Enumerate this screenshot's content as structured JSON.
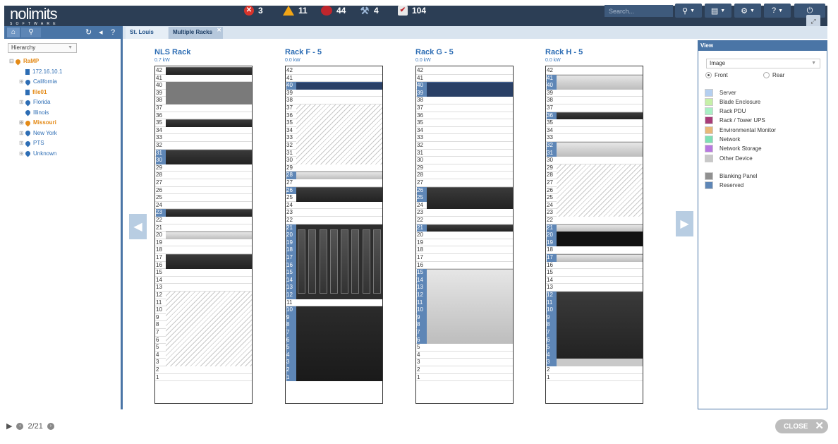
{
  "app": {
    "logo_word": "nolimits",
    "logo_sub": "SOFTWARE"
  },
  "status": {
    "errors": "3",
    "warnings": "11",
    "devices": "44",
    "tools": "4",
    "ok": "104"
  },
  "search": {
    "placeholder": "Search..."
  },
  "tabs": [
    {
      "label": "St. Louis"
    },
    {
      "label": "Multiple Racks"
    }
  ],
  "sidebar": {
    "mode": "Hierarchy",
    "tree": [
      {
        "label": "RaMP",
        "level": 0,
        "type": "location",
        "highlight": true
      },
      {
        "label": "172.16.10.1",
        "level": 1,
        "type": "device",
        "highlight": false
      },
      {
        "label": "California",
        "level": 1,
        "type": "location",
        "highlight": false
      },
      {
        "label": "file01",
        "level": 1,
        "type": "device",
        "highlight": true
      },
      {
        "label": "Florida",
        "level": 1,
        "type": "location",
        "highlight": false
      },
      {
        "label": "Illinois",
        "level": 1,
        "type": "location",
        "highlight": false
      },
      {
        "label": "Missouri",
        "level": 1,
        "type": "location",
        "highlight": true
      },
      {
        "label": "New York",
        "level": 1,
        "type": "location",
        "highlight": false
      },
      {
        "label": "PTS",
        "level": 1,
        "type": "location",
        "highlight": false
      },
      {
        "label": "Unknown",
        "level": 1,
        "type": "location",
        "highlight": false
      }
    ]
  },
  "racks": [
    {
      "name": "NLS Rack",
      "power": "0.7 kW"
    },
    {
      "name": "Rack F - 5",
      "power": "0.0 kW"
    },
    {
      "name": "Rack G - 5",
      "power": "0.0 kW"
    },
    {
      "name": "Rack H - 5",
      "power": "0.0 kW"
    }
  ],
  "view_panel": {
    "title": "View",
    "display": "Image",
    "front_label": "Front",
    "rear_label": "Rear",
    "legend": [
      {
        "label": "Server",
        "color": "#b4cff0"
      },
      {
        "label": "Blade Enclosure",
        "color": "#c6f0a8"
      },
      {
        "label": "Rack PDU",
        "color": "#a8f0c4"
      },
      {
        "label": "Rack / Tower UPS",
        "color": "#a83c78"
      },
      {
        "label": "Environmental Monitor",
        "color": "#e8b878"
      },
      {
        "label": "Network",
        "color": "#7ee0b4"
      },
      {
        "label": "Network Storage",
        "color": "#b878e0"
      },
      {
        "label": "Other Device",
        "color": "#c8c8c8"
      },
      {
        "label": "Blanking Panel",
        "color": "#909090"
      },
      {
        "label": "Reserved",
        "color": "#5e86b6"
      }
    ]
  },
  "footer": {
    "page": "2/21",
    "close_label": "CLOSE"
  }
}
